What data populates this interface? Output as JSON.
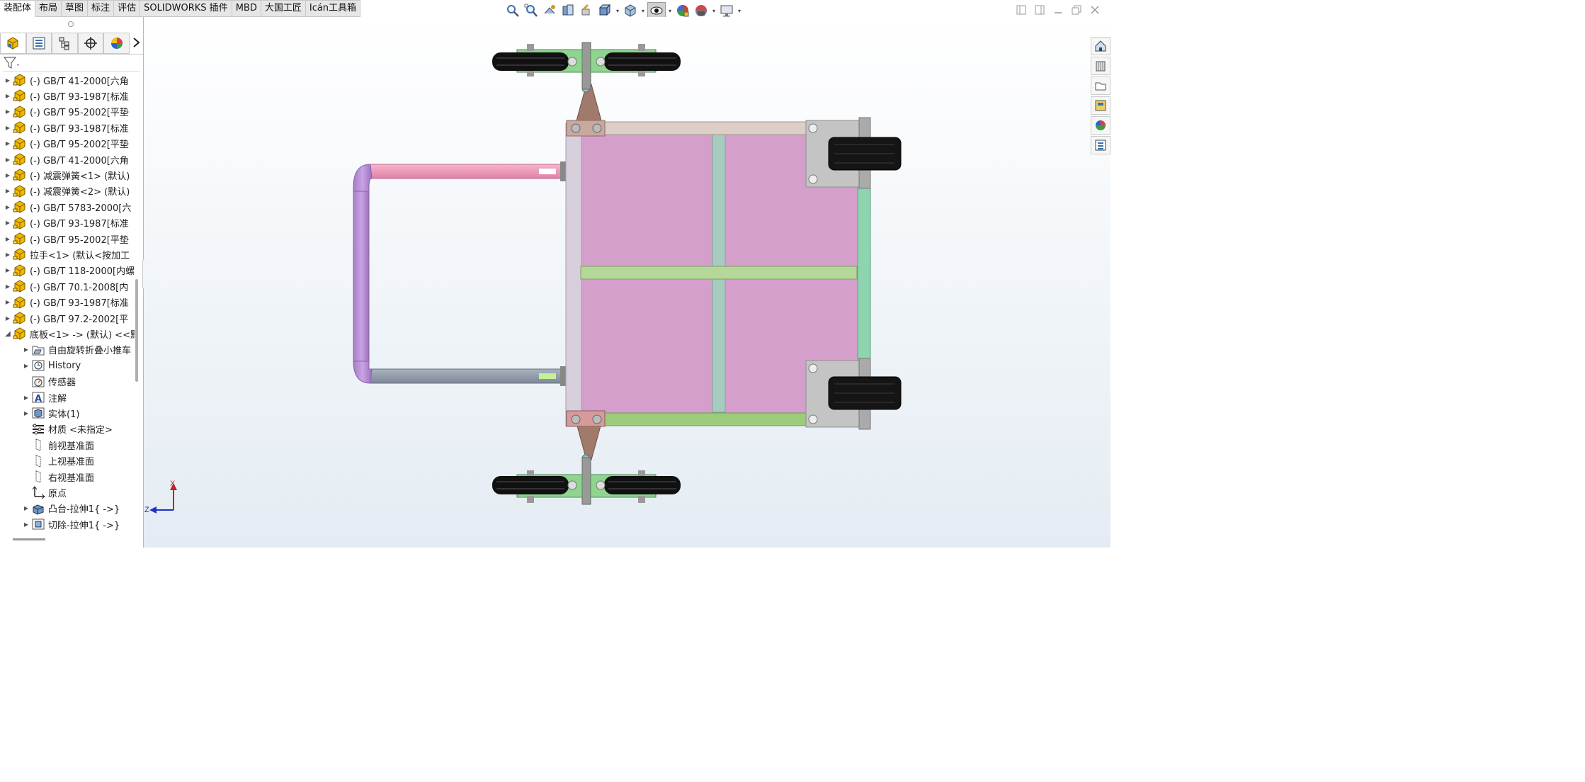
{
  "command_tabs": [
    "装配体",
    "布局",
    "草图",
    "标注",
    "评估",
    "SOLIDWORKS 插件",
    "MBD",
    "大国工匠",
    "Icán工具箱"
  ],
  "active_tab_index": 0,
  "heads_up_toolbar": {
    "icons": [
      "zoom-to-fit-icon",
      "zoom-to-area-icon",
      "previous-view-icon",
      "section-view-icon",
      "dynamic-annotation-icon",
      "view-orientation-icon",
      "display-style-icon",
      "hide-show-items-icon",
      "edit-appearance-icon",
      "apply-scene-icon",
      "view-settings-icon"
    ]
  },
  "window_controls": [
    "restore-left-icon",
    "restore-right-icon",
    "minimize-icon",
    "restore-icon",
    "close-icon"
  ],
  "panel_tabs": [
    "featuremanager-tab",
    "propertymanager-tab",
    "configurationmanager-tab",
    "dimxpert-tab",
    "displaymanager-tab"
  ],
  "feature_tree": [
    {
      "label": "(-) GB/T 41-2000[六角",
      "type": "part",
      "level": 0,
      "expandable": true
    },
    {
      "label": "(-) GB/T 93-1987[标准",
      "type": "part",
      "level": 0,
      "expandable": true
    },
    {
      "label": "(-) GB/T 95-2002[平垫",
      "type": "part",
      "level": 0,
      "expandable": true
    },
    {
      "label": "(-) GB/T 93-1987[标准",
      "type": "part",
      "level": 0,
      "expandable": true
    },
    {
      "label": "(-) GB/T 95-2002[平垫",
      "type": "part",
      "level": 0,
      "expandable": true
    },
    {
      "label": "(-) GB/T 41-2000[六角",
      "type": "part",
      "level": 0,
      "expandable": true
    },
    {
      "label": "(-) 减震弹簧<1> (默认)",
      "type": "part",
      "level": 0,
      "expandable": true
    },
    {
      "label": "(-) 减震弹簧<2> (默认)",
      "type": "part",
      "level": 0,
      "expandable": true
    },
    {
      "label": "(-) GB/T 5783-2000[六",
      "type": "part",
      "level": 0,
      "expandable": true
    },
    {
      "label": "(-) GB/T 93-1987[标准",
      "type": "part",
      "level": 0,
      "expandable": true
    },
    {
      "label": "(-) GB/T 95-2002[平垫",
      "type": "part",
      "level": 0,
      "expandable": true
    },
    {
      "label": "拉手<1> (默认<按加工",
      "type": "part",
      "level": 0,
      "expandable": true
    },
    {
      "label": "(-) GB/T 118-2000[内螺",
      "type": "part",
      "level": 0,
      "expandable": true
    },
    {
      "label": "(-) GB/T 70.1-2008[内",
      "type": "part",
      "level": 0,
      "expandable": true
    },
    {
      "label": "(-) GB/T 93-1987[标准",
      "type": "part",
      "level": 0,
      "expandable": true
    },
    {
      "label": "(-) GB/T 97.2-2002[平",
      "type": "part",
      "level": 0,
      "expandable": true
    },
    {
      "label": "底板<1> -> (默认) <<默",
      "type": "part",
      "level": 0,
      "expandable": true,
      "expanded": true
    },
    {
      "label": "自由旋转折叠小推车",
      "type": "folder",
      "level": 1,
      "expandable": true
    },
    {
      "label": "History",
      "type": "history",
      "level": 1,
      "expandable": true
    },
    {
      "label": "传感器",
      "type": "sensor",
      "level": 1,
      "expandable": false
    },
    {
      "label": "注解",
      "type": "annotation",
      "level": 1,
      "expandable": true
    },
    {
      "label": "实体(1)",
      "type": "solid",
      "level": 1,
      "expandable": true
    },
    {
      "label": "材质 <未指定>",
      "type": "material",
      "level": 1,
      "expandable": false
    },
    {
      "label": "前视基准面",
      "type": "plane",
      "level": 1,
      "expandable": false
    },
    {
      "label": "上视基准面",
      "type": "plane",
      "level": 1,
      "expandable": false
    },
    {
      "label": "右视基准面",
      "type": "plane",
      "level": 1,
      "expandable": false
    },
    {
      "label": "原点",
      "type": "origin",
      "level": 1,
      "expandable": false
    },
    {
      "label": "凸台-拉伸1{ ->}",
      "type": "extrude",
      "level": 1,
      "expandable": true
    },
    {
      "label": "切除-拉伸1{ ->}",
      "type": "cut",
      "level": 1,
      "expandable": true
    }
  ],
  "triad": {
    "x_label": "X",
    "z_label": "Z"
  },
  "task_pane": [
    "home-icon",
    "resources-icon",
    "design-library-icon",
    "file-explorer-icon",
    "appearances-icon",
    "custom-properties-icon"
  ],
  "colors": {
    "background_top": "#ffffff",
    "background_bottom": "#e4ecf3",
    "deck": "#d49fcb",
    "handle_pink": "#ee90b3",
    "handle_purple": "#b78ed4",
    "rail_green": "#9ccc7a",
    "rail_teal": "#a8cbc0",
    "tire": "#111111",
    "bracket": "#a07a6a",
    "folder_icon": "#f0b800"
  }
}
